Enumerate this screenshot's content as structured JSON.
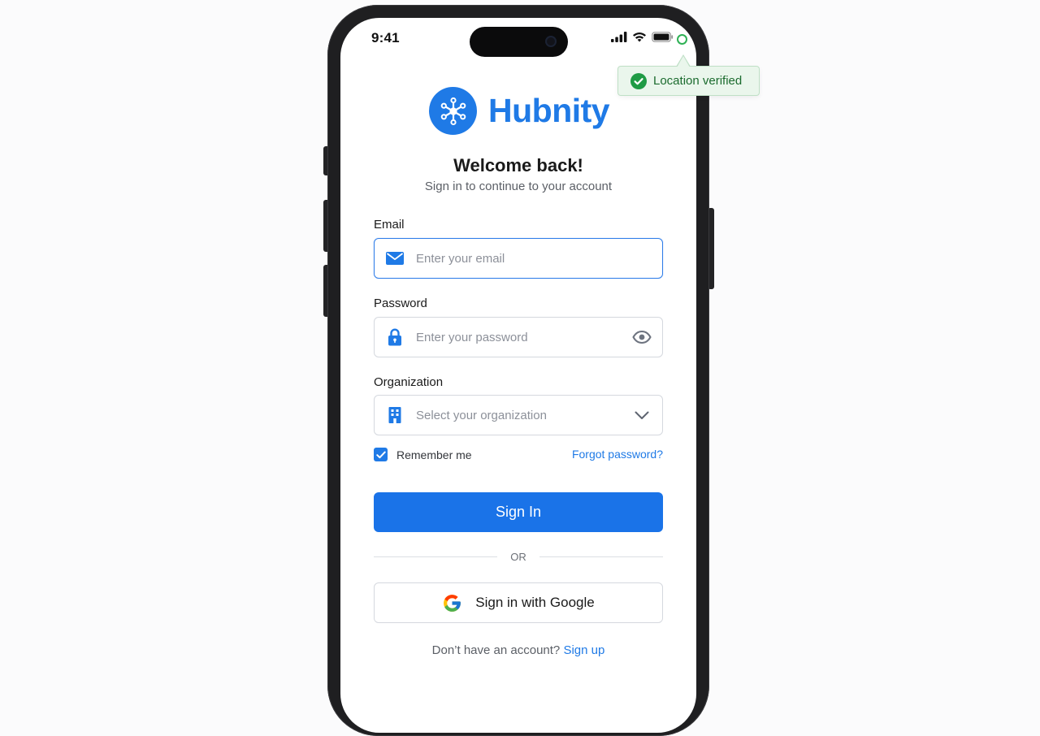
{
  "status_bar": {
    "time": "9:41",
    "icons": [
      "cellular-signal-icon",
      "wifi-icon",
      "battery-icon",
      "location-indicator-icon"
    ]
  },
  "tooltip": {
    "text": "Location verified",
    "icon": "check-circle-icon",
    "color": "#2fb155"
  },
  "brand": {
    "name": "Hubnity",
    "logo_icon": "network-hub-icon",
    "color": "#1f7ae6"
  },
  "header": {
    "title": "Welcome back!",
    "subtitle": "Sign in to continue to your account"
  },
  "form": {
    "email": {
      "label": "Email",
      "value": "",
      "placeholder": "Enter your email",
      "icon": "mail-icon"
    },
    "password": {
      "label": "Password",
      "value": "",
      "placeholder": "Enter your password",
      "icon": "lock-icon",
      "toggle_icon": "eye-icon"
    },
    "organization": {
      "label": "Organization",
      "placeholder": "Select your organization",
      "icon": "building-icon",
      "toggle_icon": "chevron-down-icon"
    },
    "remember_me": {
      "label": "Remember me",
      "checked": true
    },
    "forgot_password": "Forgot password?",
    "submit_label": "Sign In",
    "divider_text": "OR",
    "google_label": "Sign in with Google",
    "signup_prompt": "Don’t have an account?",
    "signup_link": "Sign up"
  },
  "colors": {
    "primary": "#1a73e8",
    "success": "#2fb155",
    "input_border": "#d5d8de"
  }
}
